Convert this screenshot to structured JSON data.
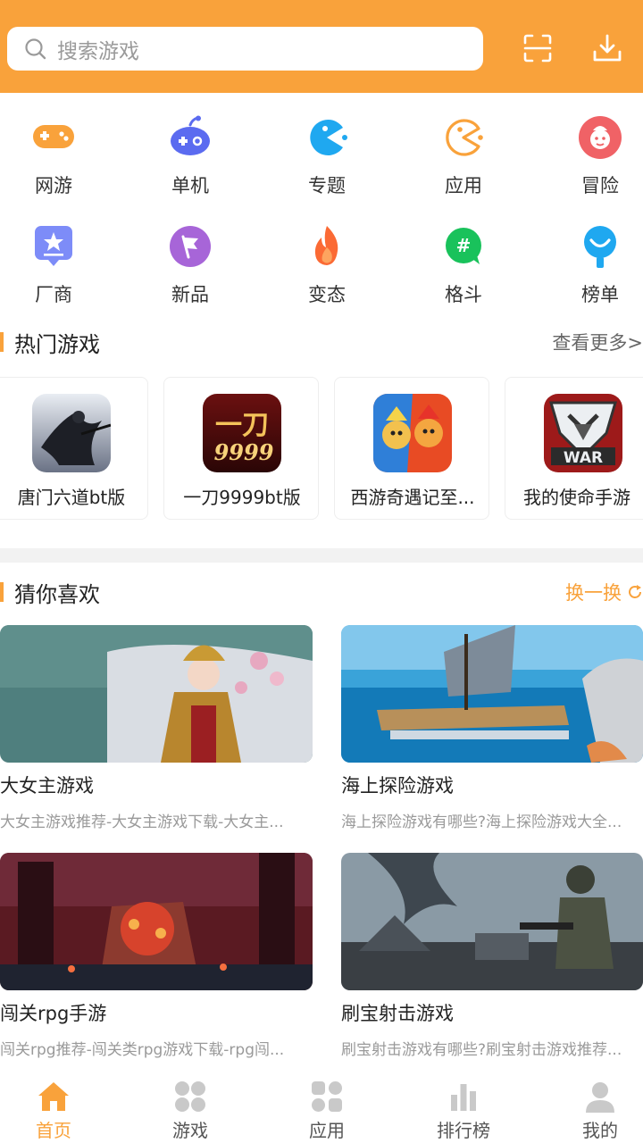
{
  "header": {
    "search_placeholder": "搜索游戏",
    "accent_color": "#f9a23b"
  },
  "categories": [
    {
      "label": "网游",
      "icon": "gamepad-icon"
    },
    {
      "label": "单机",
      "icon": "controller-icon"
    },
    {
      "label": "专题",
      "icon": "pacman-icon"
    },
    {
      "label": "应用",
      "icon": "pacman-outline-icon"
    },
    {
      "label": "冒险",
      "icon": "adventure-icon"
    },
    {
      "label": "厂商",
      "icon": "star-badge-icon"
    },
    {
      "label": "新品",
      "icon": "flag-icon"
    },
    {
      "label": "变态",
      "icon": "fire-icon"
    },
    {
      "label": "格斗",
      "icon": "hash-chat-icon"
    },
    {
      "label": "榜单",
      "icon": "ranking-icon"
    }
  ],
  "hot_section": {
    "title": "热门游戏",
    "more": "查看更多>",
    "games": [
      {
        "name": "唐门六道bt版"
      },
      {
        "name": "一刀9999bt版",
        "icon_text": "一刀",
        "icon_sub": "9999"
      },
      {
        "name": "西游奇遇记至..."
      },
      {
        "name": "我的使命手游",
        "icon_text": "WAR"
      }
    ]
  },
  "recommend_section": {
    "title": "猜你喜欢",
    "refresh": "换一换",
    "items": [
      {
        "title": "大女主游戏",
        "desc": "大女主游戏推荐-大女主游戏下载-大女主..."
      },
      {
        "title": "海上探险游戏",
        "desc": "海上探险游戏有哪些?海上探险游戏大全..."
      },
      {
        "title": "闯关rpg手游",
        "desc": "闯关rpg推荐-闯关类rpg游戏下载-rpg闯..."
      },
      {
        "title": "刷宝射击游戏",
        "desc": "刷宝射击游戏有哪些?刷宝射击游戏推荐..."
      }
    ]
  },
  "nav": {
    "items": [
      {
        "label": "首页",
        "icon": "home-icon",
        "active": true
      },
      {
        "label": "游戏",
        "icon": "grid-icon"
      },
      {
        "label": "应用",
        "icon": "apps-icon"
      },
      {
        "label": "排行榜",
        "icon": "bar-chart-icon"
      },
      {
        "label": "我的",
        "icon": "user-icon"
      }
    ]
  }
}
